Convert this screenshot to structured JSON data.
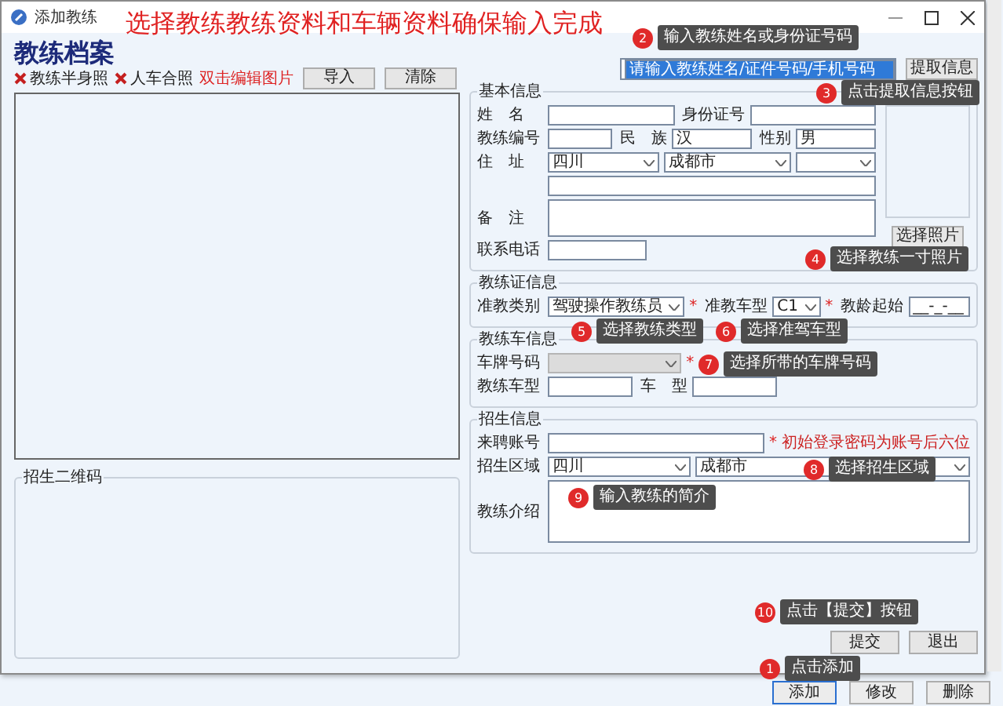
{
  "window": {
    "title": "添加教练"
  },
  "annotation": "选择教练教练资料和车辆资料确保输入完成",
  "profile": {
    "heading": "教练档案",
    "photo_tags": [
      {
        "label": "教练半身照",
        "missing": true
      },
      {
        "label": "人车合照",
        "missing": true
      }
    ],
    "hint": "双击编辑图片",
    "buttons": [
      "导入",
      "清除"
    ]
  },
  "qr_group": {
    "title": "招生二维码"
  },
  "lookup": {
    "value": "请输入教练姓名/证件号码/手机号码",
    "text_selected": true,
    "button": "提取信息"
  },
  "groups": [
    {
      "title": "基本信息",
      "photo_button": "选择照片",
      "rows": [
        [
          {
            "kind": "label",
            "text": "姓　名"
          },
          {
            "kind": "input"
          },
          {
            "kind": "label",
            "text": "身份证号"
          },
          {
            "kind": "input"
          }
        ],
        [
          {
            "kind": "label",
            "text": "教练编号"
          },
          {
            "kind": "input"
          },
          {
            "kind": "label",
            "text": "民　族"
          },
          {
            "kind": "input",
            "value": "汉"
          },
          {
            "kind": "label",
            "text": "性别"
          },
          {
            "kind": "input",
            "value": "男"
          }
        ],
        [
          {
            "kind": "label",
            "text": "住　址"
          },
          {
            "kind": "select",
            "value": "四川"
          },
          {
            "kind": "select",
            "value": "成都市"
          },
          {
            "kind": "select"
          }
        ],
        [
          {
            "kind": "label",
            "text": ""
          },
          {
            "kind": "input"
          }
        ],
        [
          {
            "kind": "label",
            "text": "备　注"
          },
          {
            "kind": "textarea"
          }
        ],
        [
          {
            "kind": "label",
            "text": "联系电话"
          },
          {
            "kind": "input"
          },
          {
            "kind": "spacer"
          }
        ]
      ]
    },
    {
      "title": "教练证信息",
      "rows": [
        [
          {
            "kind": "label",
            "text": "准教类别"
          },
          {
            "kind": "select",
            "value": "驾驶操作教练员"
          },
          {
            "kind": "required",
            "text": "*"
          },
          {
            "kind": "label",
            "text": "准教车型"
          },
          {
            "kind": "select",
            "value": "C1"
          },
          {
            "kind": "required",
            "text": "*"
          },
          {
            "kind": "label",
            "text": "教龄起始"
          },
          {
            "kind": "input",
            "value": "__-_-__"
          }
        ]
      ]
    },
    {
      "title": "教练车信息",
      "rows": [
        [
          {
            "kind": "label",
            "text": "车牌号码"
          },
          {
            "kind": "select",
            "disabled": true
          },
          {
            "kind": "required",
            "text": "*"
          },
          {
            "kind": "spacer"
          }
        ],
        [
          {
            "kind": "label",
            "text": "教练车型"
          },
          {
            "kind": "input"
          },
          {
            "kind": "label",
            "text": "车　型"
          },
          {
            "kind": "input"
          },
          {
            "kind": "spacer"
          }
        ]
      ]
    },
    {
      "title": "招生信息",
      "rows": [
        [
          {
            "kind": "label",
            "text": "来聘账号"
          },
          {
            "kind": "input"
          },
          {
            "kind": "required",
            "text": "*"
          },
          {
            "kind": "note",
            "text": "初始登录密码为账号后六位"
          }
        ],
        [
          {
            "kind": "label",
            "text": "招生区域"
          },
          {
            "kind": "select",
            "value": "四川"
          },
          {
            "kind": "select",
            "value": "成都市"
          },
          {
            "kind": "select"
          }
        ],
        [
          {
            "kind": "label",
            "text": "教练介绍"
          },
          {
            "kind": "textarea"
          }
        ]
      ]
    }
  ],
  "dialog_buttons": [
    "提交",
    "退出"
  ],
  "main_buttons": [
    {
      "label": "添加",
      "focused": true
    },
    {
      "label": "修改",
      "focused": false
    },
    {
      "label": "删除",
      "focused": false
    }
  ],
  "callouts": [
    {
      "number": "2",
      "text": "输入教练姓名或身份证号码"
    },
    {
      "number": "3",
      "text": "点击提取信息按钮"
    },
    {
      "number": "4",
      "text": "选择教练一寸照片"
    },
    {
      "number": "5",
      "text": "选择教练类型"
    },
    {
      "number": "6",
      "text": "选择准驾车型"
    },
    {
      "number": "7",
      "text": "选择所带的车牌号码"
    },
    {
      "number": "8",
      "text": "选择招生区域"
    },
    {
      "number": "9",
      "text": "输入教练的简介"
    },
    {
      "number": "10",
      "text": "点击【提交】按钮"
    },
    {
      "number": "1",
      "text": "点击添加"
    }
  ]
}
